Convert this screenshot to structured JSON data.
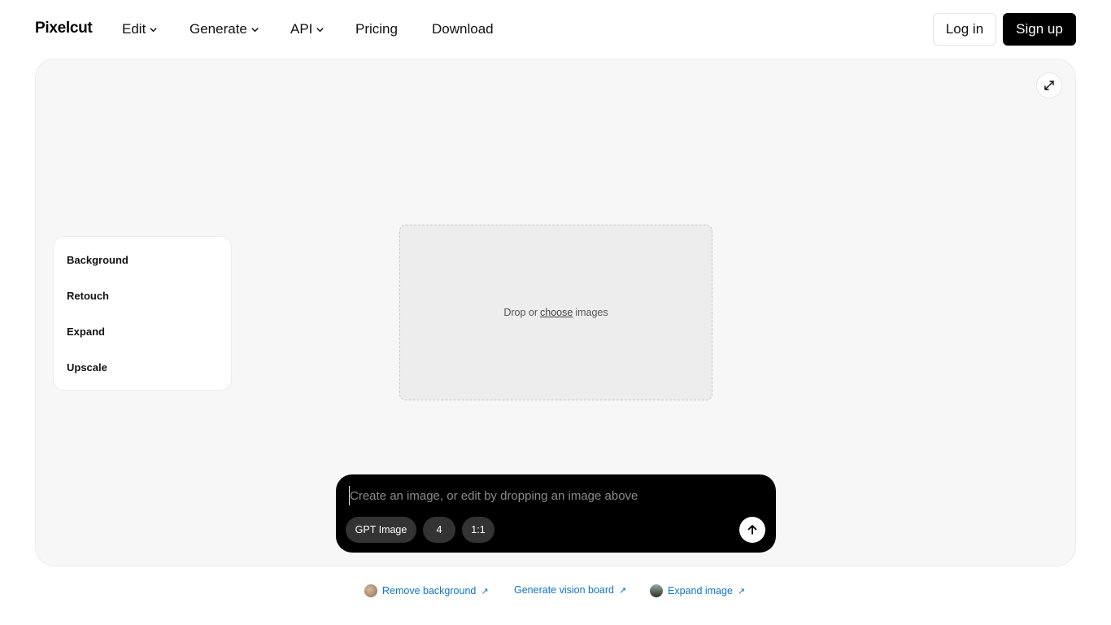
{
  "brand": "Pixelcut",
  "nav": {
    "items": [
      {
        "label": "Edit",
        "has_dropdown": true
      },
      {
        "label": "Generate",
        "has_dropdown": true
      },
      {
        "label": "API",
        "has_dropdown": true
      },
      {
        "label": "Pricing",
        "has_dropdown": false
      },
      {
        "label": "Download",
        "has_dropdown": false
      }
    ],
    "login_label": "Log in",
    "signup_label": "Sign up"
  },
  "side_menu": {
    "items": [
      "Background",
      "Retouch",
      "Expand",
      "Upscale"
    ]
  },
  "dropzone": {
    "prefix": "Drop or",
    "link": "choose",
    "suffix": "images"
  },
  "prompt": {
    "placeholder": "Create an image, or edit by dropping an image above",
    "model_chip": "GPT Image",
    "count_chip": "4",
    "ratio_chip": "1:1"
  },
  "footer_links": [
    {
      "label": "Remove background",
      "icon": "arrow-up-right-icon"
    },
    {
      "label": "Generate vision board",
      "icon": "arrow-up-right-icon"
    },
    {
      "label": "Expand image",
      "icon": "arrow-up-right-icon"
    }
  ],
  "colors": {
    "accent": "#000000",
    "link": "#1273c9",
    "canvas_bg": "#f7f7f7"
  }
}
